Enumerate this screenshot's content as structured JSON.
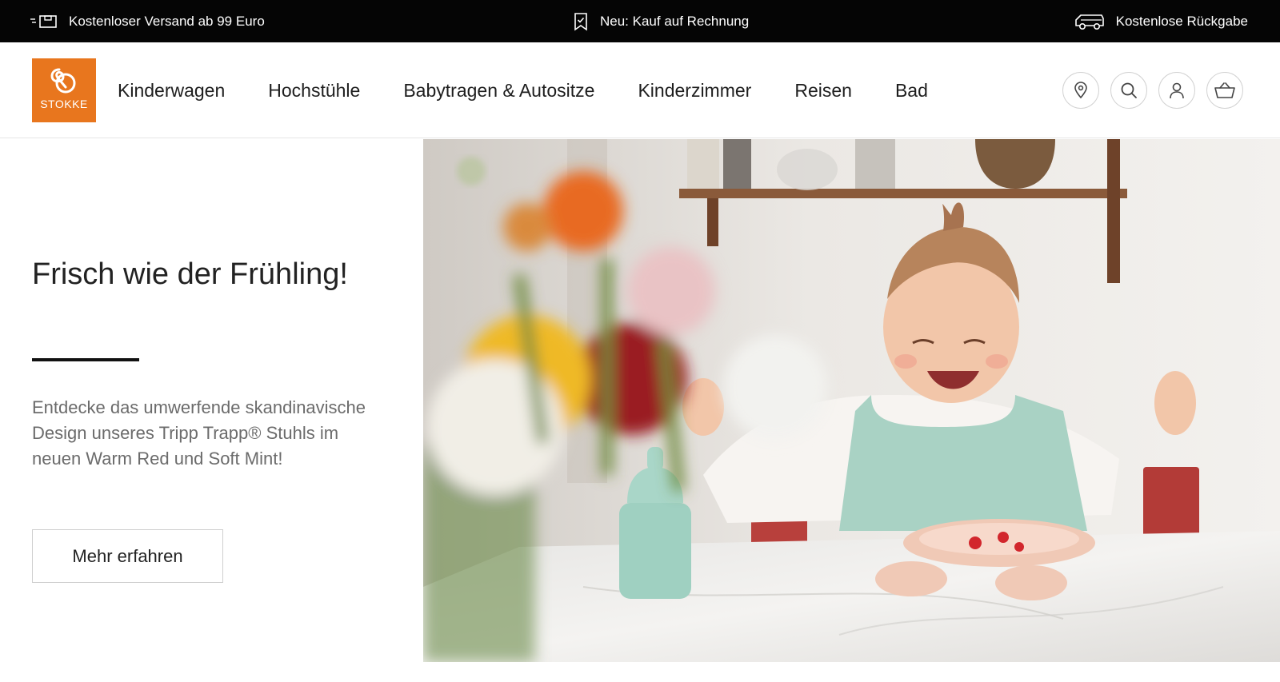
{
  "topbar": {
    "shipping": "Kostenloser Versand ab 99 Euro",
    "invoice": "Neu: Kauf auf Rechnung",
    "returns": "Kostenlose Rückgabe"
  },
  "brand": {
    "name": "STOKKE",
    "color": "#e8761e"
  },
  "nav": {
    "items": [
      "Kinderwagen",
      "Hochstühle",
      "Babytragen & Autositze",
      "Kinderzimmer",
      "Reisen",
      "Bad"
    ]
  },
  "header_icons": [
    "location-pin-icon",
    "search-icon",
    "user-icon",
    "basket-icon"
  ],
  "hero": {
    "headline": "Frisch wie der Frühling!",
    "description": "Entdecke das umwerfende skandinavische Design unseres Tripp Trapp® Stuhls im neuen Warm Red und Soft Mint!",
    "cta": "Mehr erfahren"
  }
}
